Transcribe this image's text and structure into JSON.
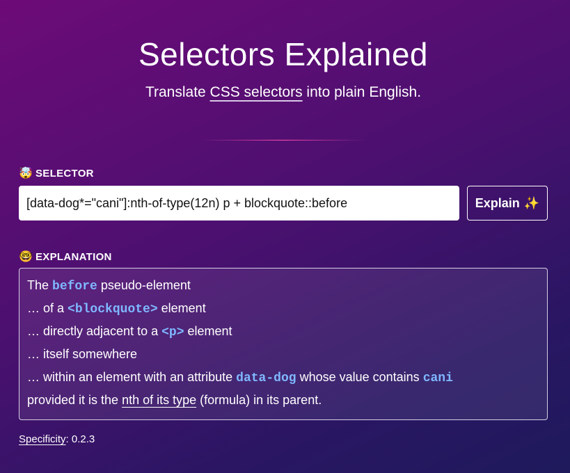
{
  "header": {
    "title": "Selectors Explained",
    "subtitle_before": "Translate ",
    "subtitle_link": "CSS selectors",
    "subtitle_after": " into plain English."
  },
  "selector_section": {
    "emoji": "🤯",
    "label": "SELECTOR",
    "input_value": "[data-dog*=\"cani\"]:nth-of-type(12n) p + blockquote::before",
    "button_label": "Explain",
    "button_emoji": "✨"
  },
  "explanation_section": {
    "emoji": "🤓",
    "label": "EXPLANATION",
    "lines": {
      "l1": {
        "a": "The ",
        "code": "before",
        "b": " pseudo-element"
      },
      "l2": {
        "a": "… of a ",
        "code": "<blockquote>",
        "b": " element"
      },
      "l3": {
        "a": "… directly adjacent to a ",
        "code": "<p>",
        "b": " element"
      },
      "l4": {
        "a": "… itself somewhere"
      },
      "l5": {
        "a": "… within an element with an attribute ",
        "code1": "data-dog",
        "b": " whose value contains ",
        "code2": "cani"
      },
      "l6": {
        "a": "provided it is the ",
        "link": "nth of its type",
        "b": " (formula) in its parent."
      }
    }
  },
  "footer": {
    "specificity_label": "Specificity",
    "specificity_sep": ": ",
    "specificity_value": "0.2.3"
  },
  "colors": {
    "code": "#7fb8ff",
    "divider": "#ff4fb0",
    "bg_start": "#6d0b78",
    "bg_end": "#1e1a5c"
  }
}
